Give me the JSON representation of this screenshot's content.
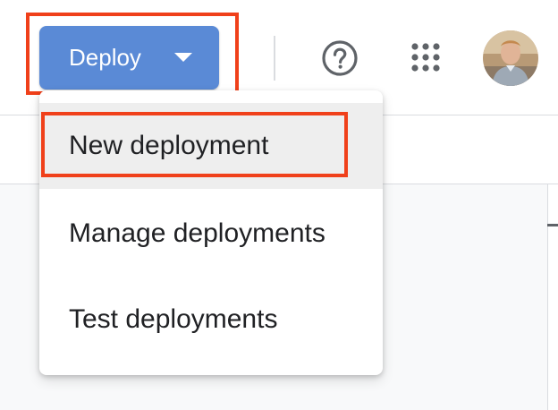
{
  "header": {
    "deploy_button_label": "Deploy",
    "help_icon": "help-circle-icon",
    "apps_icon": "apps-grid-icon",
    "avatar": "user-avatar"
  },
  "deploy_menu": {
    "items": [
      {
        "label": "New deployment",
        "highlighted": true
      },
      {
        "label": "Manage deployments",
        "highlighted": false
      },
      {
        "label": "Test deployments",
        "highlighted": false
      }
    ]
  },
  "colors": {
    "deploy_button": "#5a8ad6",
    "highlight_outline": "#f0401a",
    "menu_active_background": "#eeeeee",
    "text": "#202124",
    "icon": "#5f6368"
  }
}
